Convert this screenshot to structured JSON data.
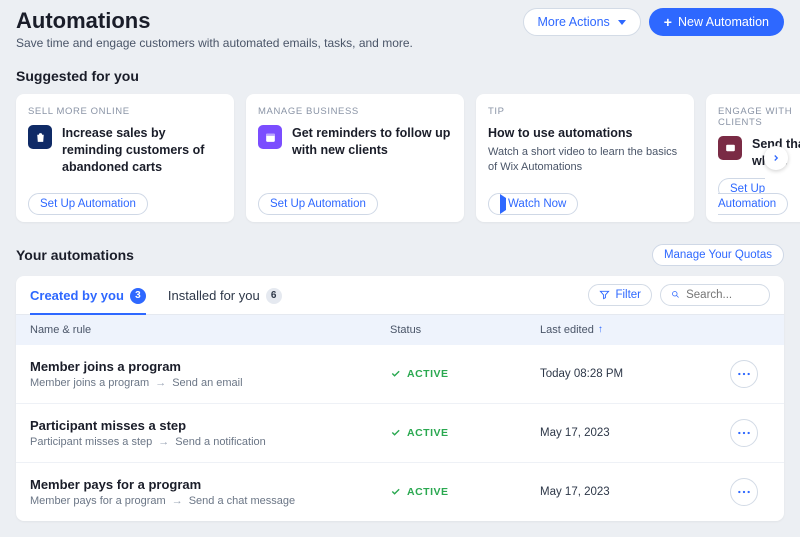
{
  "header": {
    "title": "Automations",
    "subtitle": "Save time and engage customers with automated emails, tasks, and more.",
    "more_actions_label": "More Actions",
    "new_automation_label": "New Automation"
  },
  "suggested": {
    "heading": "Suggested for you",
    "setup_label": "Set Up Automation",
    "watch_label": "Watch Now",
    "cards": [
      {
        "eyebrow": "SELL MORE ONLINE",
        "title": "Increase sales by reminding customers of abandoned carts",
        "desc": "",
        "icon": "bag",
        "cta": "setup"
      },
      {
        "eyebrow": "MANAGE BUSINESS",
        "title": "Get reminders to follow up with new clients",
        "desc": "",
        "icon": "calendar",
        "cta": "setup"
      },
      {
        "eyebrow": "TIP",
        "title": "How to use automations",
        "desc": "Watch a short video to learn the basics of Wix Automations",
        "icon": "",
        "cta": "watch"
      },
      {
        "eyebrow": "ENGAGE WITH CLIENTS",
        "title": "Send thank who s",
        "desc": "",
        "icon": "chat",
        "cta": "setup"
      }
    ]
  },
  "your_automations": {
    "heading": "Your automations",
    "manage_quotas_label": "Manage Your Quotas",
    "tabs": [
      {
        "label": "Created by you",
        "count": 3,
        "active": true
      },
      {
        "label": "Installed for you",
        "count": 6,
        "active": false
      }
    ],
    "filter_label": "Filter",
    "search_placeholder": "Search...",
    "columns": {
      "name": "Name & rule",
      "status": "Status",
      "edited": "Last edited"
    },
    "status_active_label": "ACTIVE",
    "rows": [
      {
        "name": "Member joins a program",
        "rule_trigger": "Member joins a program",
        "rule_action": "Send an email",
        "status": "active",
        "last_edited": "Today 08:28 PM"
      },
      {
        "name": "Participant misses a step",
        "rule_trigger": "Participant misses a step",
        "rule_action": "Send a notification",
        "status": "active",
        "last_edited": "May 17, 2023"
      },
      {
        "name": "Member pays for a program",
        "rule_trigger": "Member pays for a program",
        "rule_action": "Send a chat message",
        "status": "active",
        "last_edited": "May 17, 2023"
      }
    ]
  }
}
